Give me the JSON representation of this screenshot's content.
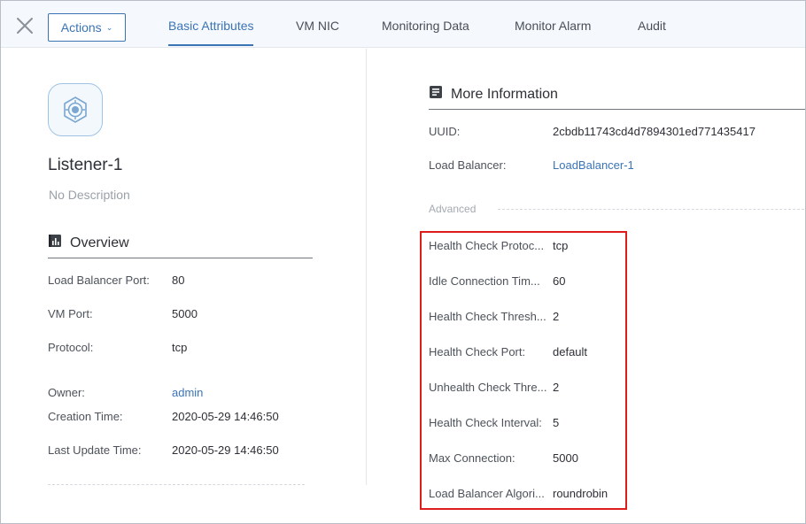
{
  "header": {
    "actions_label": "Actions",
    "tabs": [
      {
        "label": "Basic Attributes",
        "active": true
      },
      {
        "label": "VM NIC",
        "active": false
      },
      {
        "label": "Monitoring Data",
        "active": false
      },
      {
        "label": "Monitor Alarm",
        "active": false
      },
      {
        "label": "Audit",
        "active": false
      }
    ]
  },
  "resource": {
    "name": "Listener-1",
    "description": "No Description",
    "icon": "listener-icon"
  },
  "overview": {
    "title": "Overview",
    "icon": "chart-book-icon",
    "fields": [
      {
        "label": "Load Balancer Port:",
        "value": "80"
      },
      {
        "label": "VM Port:",
        "value": "5000"
      },
      {
        "label": "Protocol:",
        "value": "tcp"
      },
      {
        "label": "Owner:",
        "value": "admin"
      },
      {
        "label": "Creation Time:",
        "value": "2020-05-29 14:46:50"
      },
      {
        "label": "Last Update Time:",
        "value": "2020-05-29 14:46:50"
      }
    ]
  },
  "more_info": {
    "title": "More Information",
    "icon": "document-icon",
    "fields": [
      {
        "label": "UUID:",
        "value": "2cbdb11743cd4d7894301ed771435417"
      },
      {
        "label": "Load Balancer:",
        "value": "LoadBalancer-1"
      }
    ],
    "advanced_label": "Advanced",
    "advanced_fields": [
      {
        "label": "Health Check Protoc...",
        "value": "tcp"
      },
      {
        "label": "Idle Connection Tim...",
        "value": "60"
      },
      {
        "label": "Health Check Thresh...",
        "value": "2"
      },
      {
        "label": "Health Check Port:",
        "value": "default"
      },
      {
        "label": "Unhealth Check Thre...",
        "value": "2"
      },
      {
        "label": "Health Check Interval:",
        "value": "5"
      },
      {
        "label": "Max Connection:",
        "value": "5000"
      },
      {
        "label": "Load Balancer Algori...",
        "value": "roundrobin"
      }
    ]
  },
  "colors": {
    "accent": "#3b74b5",
    "highlight_border": "#dd1c1c",
    "header_bg": "#f5f8fc"
  }
}
